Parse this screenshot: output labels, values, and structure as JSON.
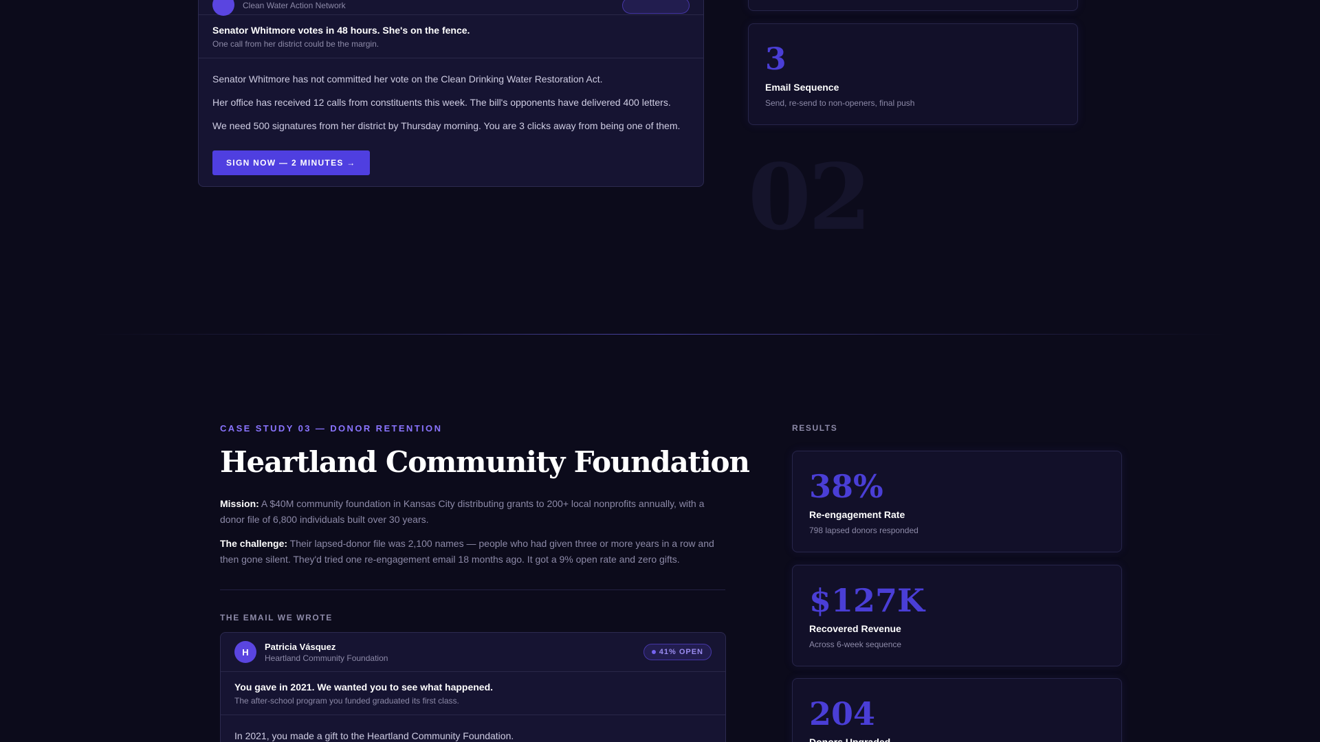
{
  "case2": {
    "email": {
      "org": "Clean Water Action Network",
      "subject": "Senator Whitmore votes in 48 hours. She's on the fence.",
      "preview": "One call from her district could be the margin.",
      "body": [
        "Senator Whitmore has not committed her vote on the Clean Drinking Water Restoration Act.",
        "Her office has received 12 calls from constituents this week. The bill's opponents have delivered 400 letters.",
        "We need 500 signatures from her district by Thursday morning. You are 3 clicks away from being one of them."
      ],
      "cta": "SIGN NOW — 2 MINUTES →"
    },
    "step": {
      "number": "3",
      "title": "Email Sequence",
      "desc": "Send, re-send to non-openers, final push"
    },
    "big_number": "02"
  },
  "case3": {
    "eyebrow": "CASE STUDY 03 — DONOR RETENTION",
    "title": "Heartland Community Foundation",
    "mission_label": "Mission:",
    "mission_text": "A $40M community foundation in Kansas City distributing grants to 200+ local nonprofits annually, with a donor file of 6,800 individuals built over 30 years.",
    "challenge_label": "The challenge:",
    "challenge_text": "Their lapsed-donor file was 2,100 names — people who had given three or more years in a row and then gone silent. They'd tried one re-engagement email 18 months ago. It got a 9% open rate and zero gifts.",
    "email_section_label": "THE EMAIL WE WROTE",
    "email": {
      "avatar_letter": "H",
      "sender": "Patricia Vásquez",
      "org": "Heartland Community Foundation",
      "badge": "41% OPEN",
      "subject": "You gave in 2021. We wanted you to see what happened.",
      "preview": "The after-school program you funded graduated its first class.",
      "body_first": "In 2021, you made a gift to the Heartland Community Foundation."
    },
    "results_label": "RESULTS",
    "results": [
      {
        "value": "38%",
        "label": "Re-engagement Rate",
        "desc": "798 lapsed donors responded"
      },
      {
        "value": "$127K",
        "label": "Recovered Revenue",
        "desc": "Across 6-week sequence"
      },
      {
        "value": "204",
        "label": "Donors Upgraded",
        "desc": ""
      }
    ]
  }
}
